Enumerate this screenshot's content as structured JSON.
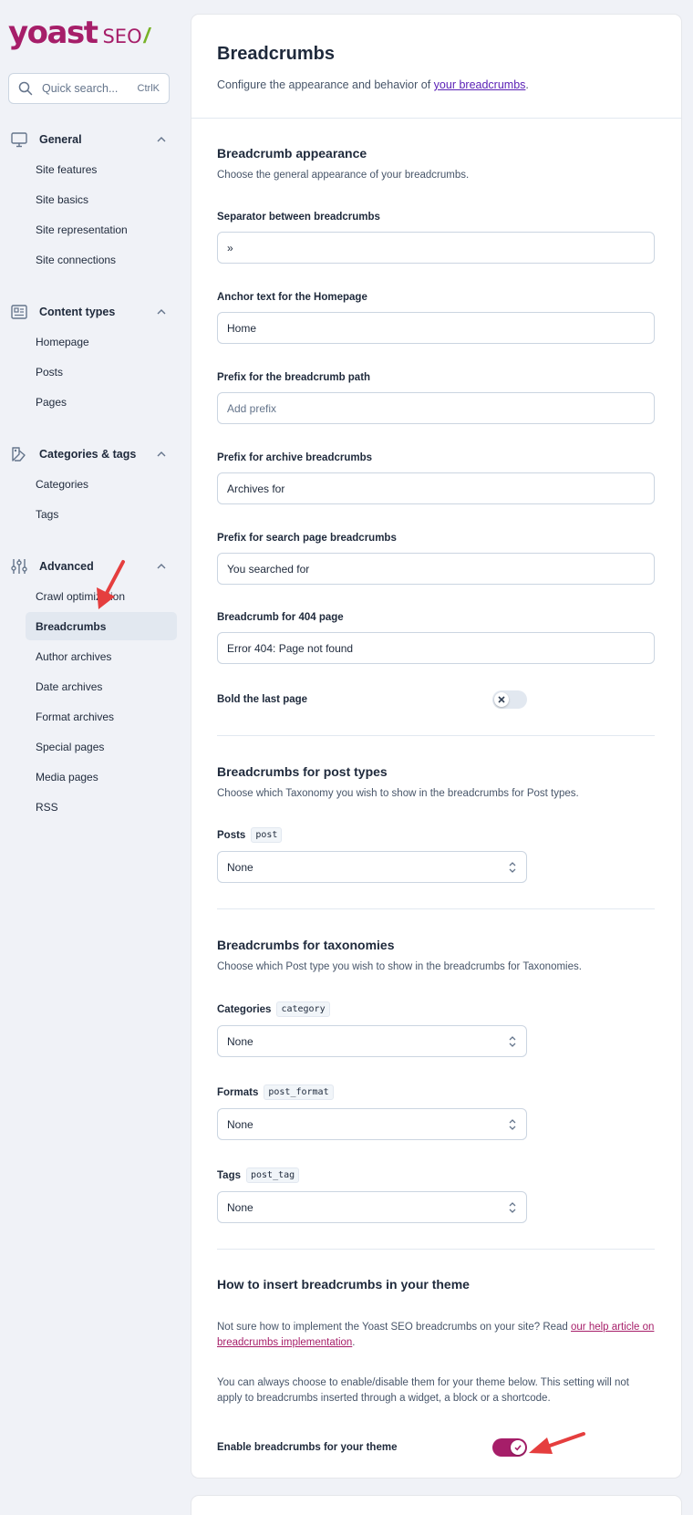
{
  "logo": {
    "text": "yoast",
    "product": "SEO",
    "slash": "/"
  },
  "search": {
    "placeholder": "Quick search...",
    "shortcut": "CtrlK"
  },
  "sidebar": {
    "groups": [
      {
        "label": "General",
        "icon": "desktop-icon",
        "items": [
          "Site features",
          "Site basics",
          "Site representation",
          "Site connections"
        ]
      },
      {
        "label": "Content types",
        "icon": "newspaper-icon",
        "items": [
          "Homepage",
          "Posts",
          "Pages"
        ]
      },
      {
        "label": "Categories & tags",
        "icon": "tag-icon",
        "items": [
          "Categories",
          "Tags"
        ]
      },
      {
        "label": "Advanced",
        "icon": "sliders-icon",
        "items": [
          "Crawl optimization",
          "Breadcrumbs",
          "Author archives",
          "Date archives",
          "Format archives",
          "Special pages",
          "Media pages",
          "RSS"
        ],
        "active": "Breadcrumbs"
      }
    ]
  },
  "page": {
    "title": "Breadcrumbs",
    "desc_prefix": "Configure the appearance and behavior of ",
    "desc_link": "your breadcrumbs",
    "desc_suffix": "."
  },
  "appearance": {
    "title": "Breadcrumb appearance",
    "desc": "Choose the general appearance of your breadcrumbs.",
    "fields": {
      "separator": {
        "label": "Separator between breadcrumbs",
        "value": "»",
        "placeholder": ""
      },
      "home": {
        "label": "Anchor text for the Homepage",
        "value": "Home",
        "placeholder": ""
      },
      "prefix": {
        "label": "Prefix for the breadcrumb path",
        "value": "",
        "placeholder": "Add prefix"
      },
      "archive": {
        "label": "Prefix for archive breadcrumbs",
        "value": "Archives for",
        "placeholder": ""
      },
      "search": {
        "label": "Prefix for search page breadcrumbs",
        "value": "You searched for",
        "placeholder": ""
      },
      "notfound": {
        "label": "Breadcrumb for 404 page",
        "value": "Error 404: Page not found",
        "placeholder": ""
      }
    },
    "bold_last": {
      "label": "Bold the last page",
      "enabled": false
    }
  },
  "post_types": {
    "title": "Breadcrumbs for post types",
    "desc": "Choose which Taxonomy you wish to show in the breadcrumbs for Post types.",
    "posts": {
      "label": "Posts",
      "code": "post",
      "value": "None"
    }
  },
  "taxonomies": {
    "title": "Breadcrumbs for taxonomies",
    "desc": "Choose which Post type you wish to show in the breadcrumbs for Taxonomies.",
    "categories": {
      "label": "Categories",
      "code": "category",
      "value": "None"
    },
    "formats": {
      "label": "Formats",
      "code": "post_format",
      "value": "None"
    },
    "tags": {
      "label": "Tags",
      "code": "post_tag",
      "value": "None"
    }
  },
  "insert": {
    "title": "How to insert breadcrumbs in your theme",
    "para1_prefix": "Not sure how to implement the Yoast SEO breadcrumbs on your site? Read ",
    "para1_link": "our help article on breadcrumbs implementation",
    "para1_suffix": ".",
    "para2": "You can always choose to enable/disable them for your theme below. This setting will not apply to breadcrumbs inserted through a widget, a block or a shortcode.",
    "enable": {
      "label": "Enable breadcrumbs for your theme",
      "enabled": true
    }
  },
  "colors": {
    "brand": "#a61e69",
    "accent_green": "#77b227",
    "link": "#5b21b6",
    "arrow": "#e53e3e"
  }
}
